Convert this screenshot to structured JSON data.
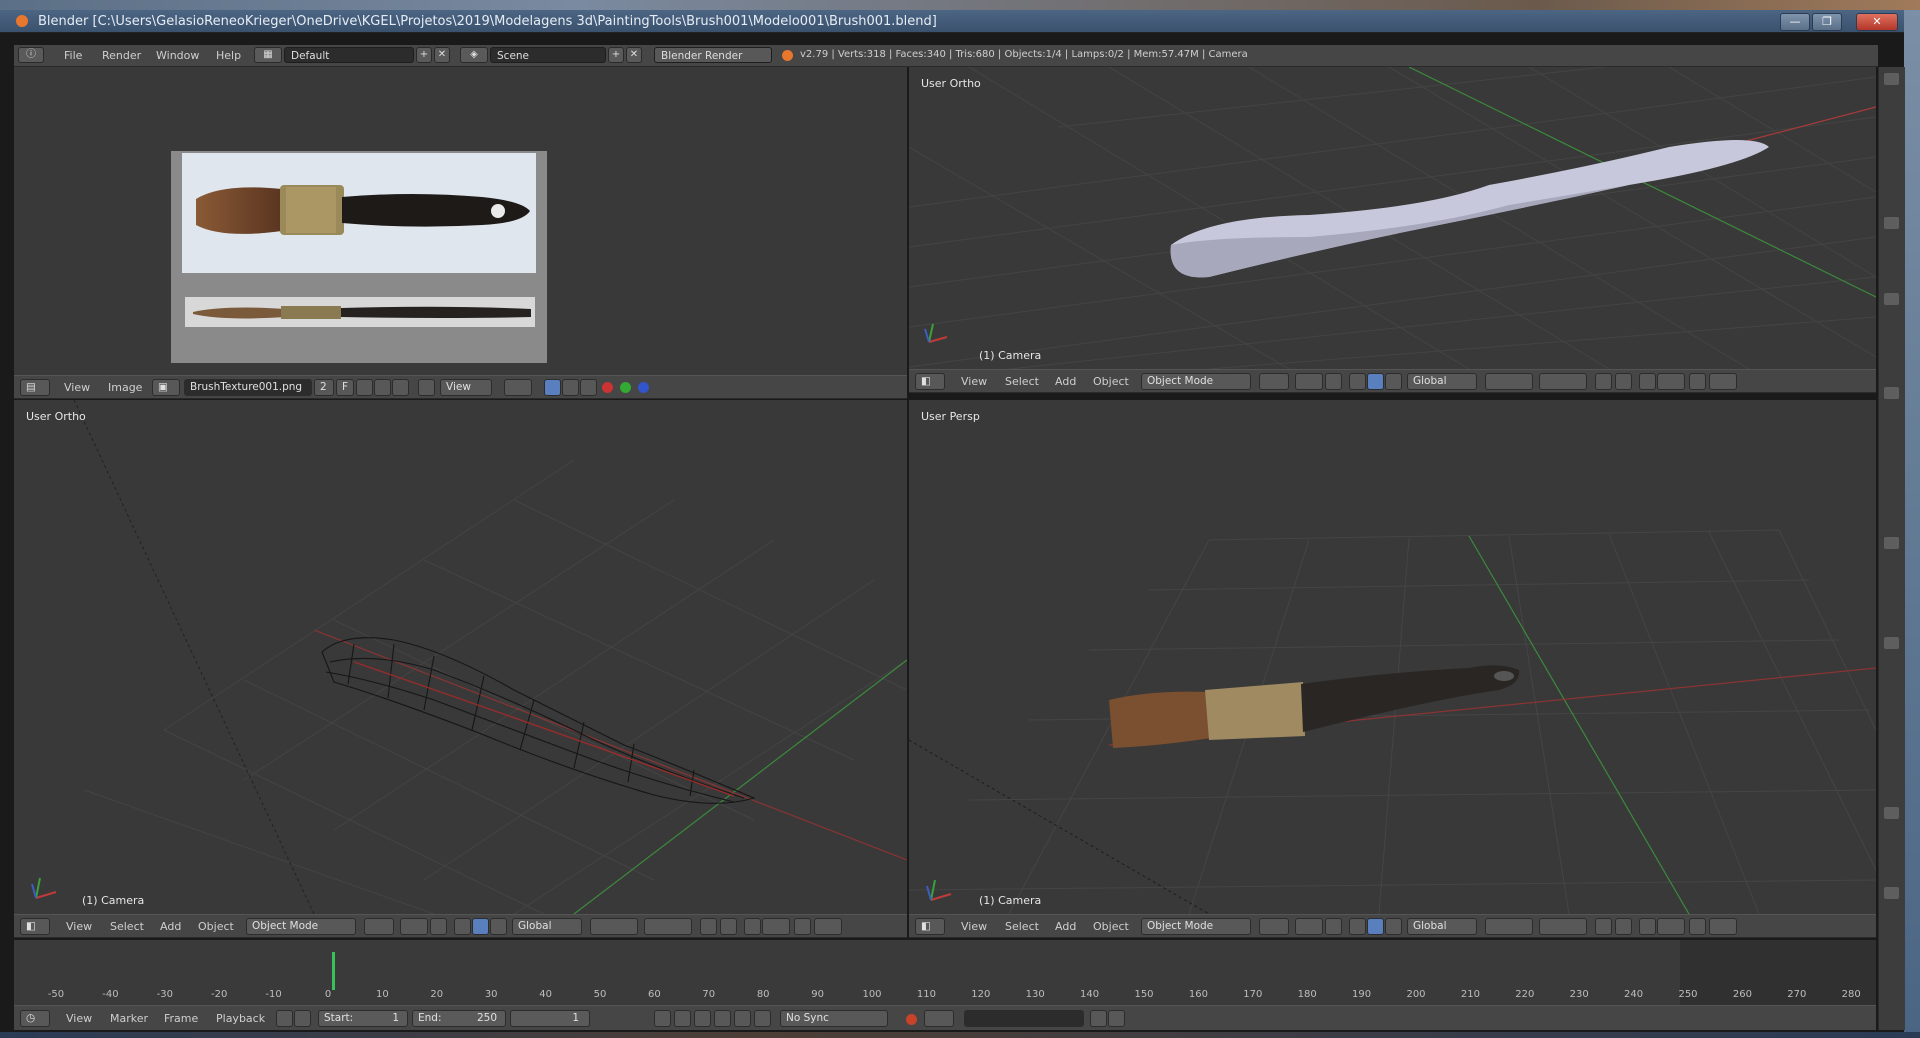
{
  "window": {
    "title": "Blender [C:\\Users\\GelasioReneoKrieger\\OneDrive\\KGEL\\Projetos\\2019\\Modelagens 3d\\PaintingTools\\Brush001\\Modelo001\\Brush001.blend]",
    "minimize": "—",
    "maximize": "❐",
    "close": "✕"
  },
  "info": {
    "menu": [
      "File",
      "Render",
      "Window",
      "Help"
    ],
    "layout": "Default",
    "scene": "Scene",
    "engine": "Blender Render",
    "stats": "v2.79 | Verts:318 | Faces:340 | Tris:680 | Objects:1/4 | Lamps:0/2 | Mem:57.47M | Camera"
  },
  "image_editor": {
    "menu": [
      "View",
      "Image"
    ],
    "image_name": "BrushTexture001.png",
    "users": "2",
    "fake": "F",
    "view_label": "View"
  },
  "viewports": {
    "top_right": {
      "label": "User Ortho",
      "object": "(1) Camera"
    },
    "bottom_left": {
      "label": "User Ortho",
      "object": "(1) Camera"
    },
    "bottom_right": {
      "label": "User Persp",
      "object": "(1) Camera"
    }
  },
  "view3d_header": {
    "menu": [
      "View",
      "Select",
      "Add",
      "Object"
    ],
    "mode": "Object Mode",
    "orientation": "Global"
  },
  "timeline": {
    "ticks": [
      "-50",
      "-40",
      "-30",
      "-20",
      "-10",
      "0",
      "10",
      "20",
      "30",
      "40",
      "50",
      "60",
      "70",
      "80",
      "90",
      "100",
      "110",
      "120",
      "130",
      "140",
      "150",
      "160",
      "170",
      "180",
      "190",
      "200",
      "210",
      "220",
      "230",
      "240",
      "250",
      "260",
      "270",
      "280"
    ],
    "menu": [
      "View",
      "Marker",
      "Frame",
      "Playback"
    ],
    "start_label": "Start:",
    "start": "1",
    "end_label": "End:",
    "end": "250",
    "current": "1",
    "sync": "No Sync"
  },
  "colors": {
    "x_axis": "#c03a3a",
    "y_axis": "#3aa03a",
    "accent": "#e8772e",
    "cursor": "#39c05a"
  }
}
